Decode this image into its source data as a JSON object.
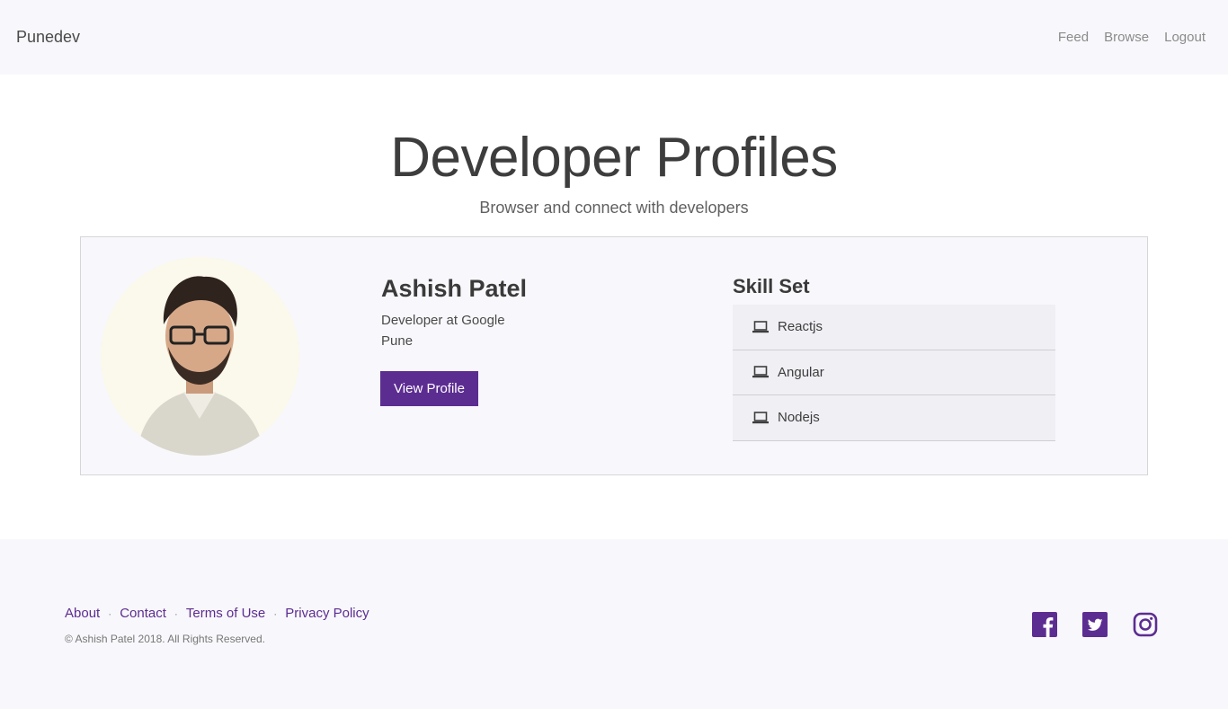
{
  "nav": {
    "brand": "Punedev",
    "links": [
      "Feed",
      "Browse",
      "Logout"
    ]
  },
  "hero": {
    "title": "Developer Profiles",
    "subtitle": "Browser and connect with developers"
  },
  "profile": {
    "name": "Ashish Patel",
    "role": "Developer at Google",
    "location": "Pune",
    "button_label": "View Profile",
    "skills_title": "Skill Set",
    "skills": [
      "Reactjs",
      "Angular",
      "Nodejs"
    ]
  },
  "footer": {
    "links": [
      "About",
      "Contact",
      "Terms of Use",
      "Privacy Policy"
    ],
    "copyright": "© Ashish Patel 2018. All Rights Reserved.",
    "social": [
      "facebook-icon",
      "twitter-icon",
      "instagram-icon"
    ]
  },
  "colors": {
    "accent": "#5c2d91",
    "nav_bg": "#f8f7fb"
  }
}
